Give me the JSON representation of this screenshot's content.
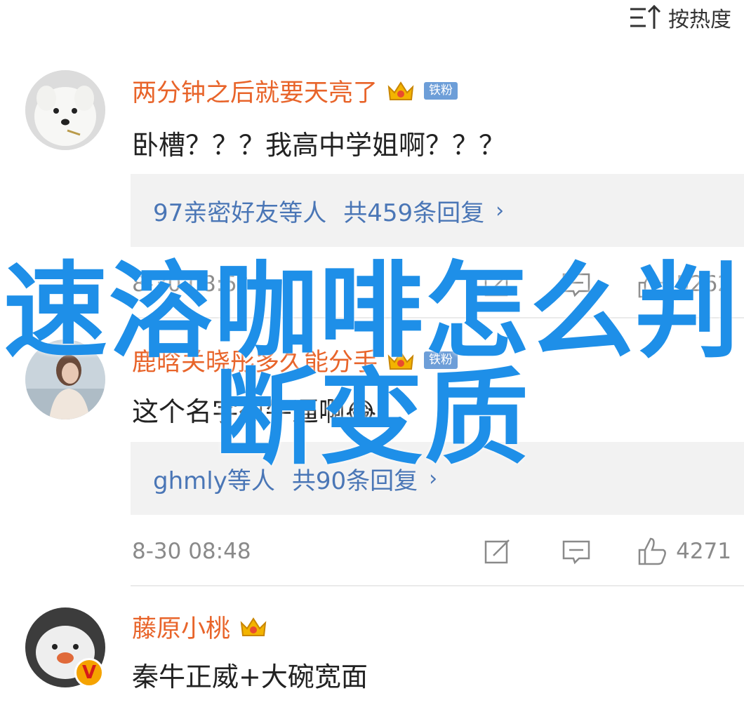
{
  "sort": {
    "label": "按热度",
    "icon": "sort-up-icon"
  },
  "comments": [
    {
      "username": "两分钟之后就要天亮了",
      "fan_badge": "铁粉",
      "text": "卧槽？？？我高中学姐啊？？？",
      "reply": {
        "names": "97亲密好友等人",
        "count_text": "共459条回复"
      },
      "time": "8-30 08:5?",
      "likes": "5262"
    },
    {
      "username": "鹿晗关晓彤多久能分手",
      "fan_badge": "铁粉",
      "text": "这个名字很牛逼啊😂",
      "reply": {
        "names": "ghmly等人",
        "count_text": "共90条回复"
      },
      "time": "8-30 08:48",
      "likes": "4271"
    },
    {
      "username": "藤原小桃",
      "text": "秦牛正威+大碗宽面",
      "verified_badge": "V"
    }
  ],
  "overlay": {
    "line1": "速溶咖啡怎么判",
    "line2": "断变质"
  },
  "colors": {
    "username": "#e8642a",
    "reply": "#4a76b6",
    "overlay": "#1e8fe8",
    "fan_badge": "#6d9ed8"
  }
}
